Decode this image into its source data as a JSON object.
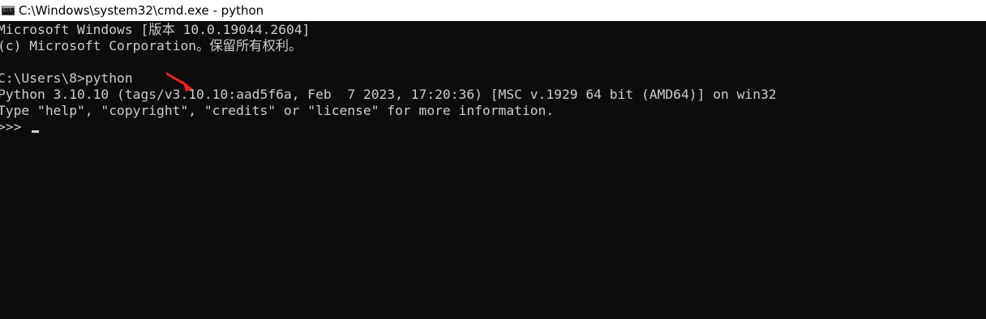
{
  "window": {
    "title": "C:\\Windows\\system32\\cmd.exe - python",
    "icon": "cmd-icon"
  },
  "console": {
    "lines": [
      "Microsoft Windows [版本 10.0.19044.2604]",
      "(c) Microsoft Corporation。保留所有权利。",
      "",
      "C:\\Users\\8>python",
      "Python 3.10.10 (tags/v3.10.10:aad5f6a, Feb  7 2023, 17:20:36) [MSC v.1929 64 bit (AMD64)] on win32",
      "Type \"help\", \"copyright\", \"credits\" or \"license\" for more information."
    ],
    "prompt": ">>> "
  },
  "annotation": {
    "arrow_color": "#e8231c"
  },
  "colors": {
    "background": "#0c0c0c",
    "text": "#cccccc",
    "titlebar": "#ffffff"
  }
}
